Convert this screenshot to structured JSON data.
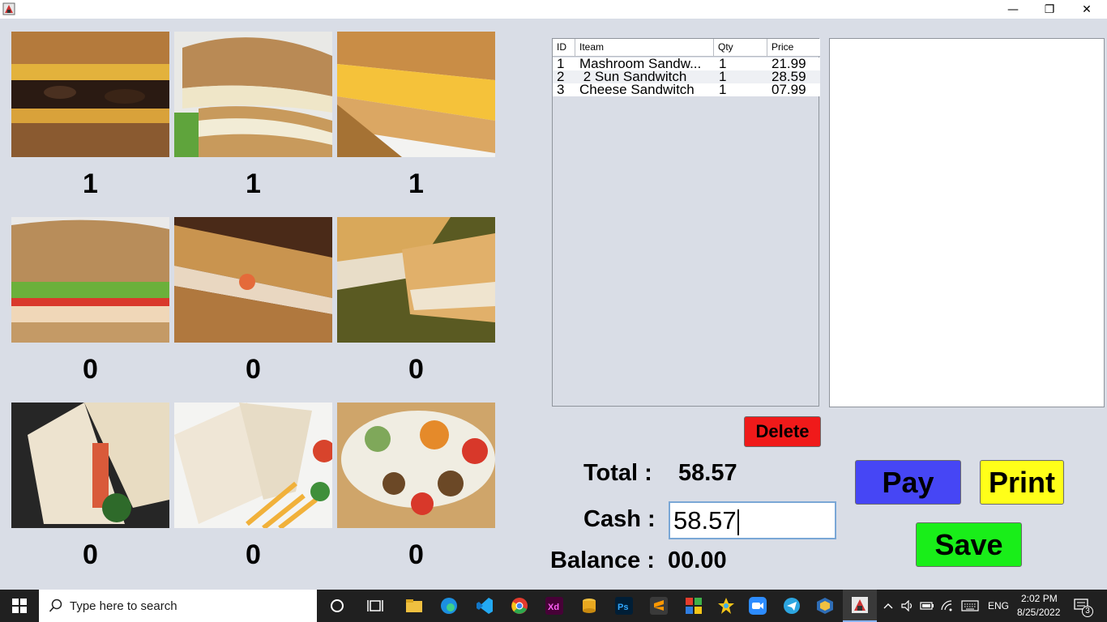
{
  "window": {
    "controls": {
      "minimize": "—",
      "restore": "❐",
      "close": "✕"
    }
  },
  "products": [
    {
      "name": "mashroom-sandwich",
      "qty": "1"
    },
    {
      "name": "sun-sandwich",
      "qty": "1"
    },
    {
      "name": "cheese-sandwich",
      "qty": "1"
    },
    {
      "name": "club-sandwich",
      "qty": "0"
    },
    {
      "name": "tuna-panini",
      "qty": "0"
    },
    {
      "name": "chicken-toast",
      "qty": "0"
    },
    {
      "name": "triangle-sandwich",
      "qty": "0"
    },
    {
      "name": "wrap",
      "qty": "0"
    },
    {
      "name": "falafel-pita",
      "qty": "0"
    }
  ],
  "table": {
    "headers": {
      "id": "ID",
      "item": "Iteam",
      "qty": "Qty",
      "price": "Price"
    },
    "rows": [
      {
        "id": "1",
        "item": "Mashroom Sandw...",
        "qty": "1",
        "price": "21.99"
      },
      {
        "id": "2",
        "item": " 2 Sun Sandwitch",
        "qty": "1",
        "price": "28.59"
      },
      {
        "id": "3",
        "item": "Cheese Sandwitch",
        "qty": "1",
        "price": "07.99"
      }
    ]
  },
  "actions": {
    "delete": "Delete",
    "pay": "Pay",
    "print": "Print",
    "save": "Save"
  },
  "summary": {
    "total_label": "Total :",
    "total_value": "58.57",
    "cash_label": "Cash :",
    "cash_value": "58.57",
    "balance_label": "Balance :",
    "balance_value": "00.00"
  },
  "colors": {
    "delete": "#f01a1a",
    "pay": "#4646f5",
    "print": "#ffff19",
    "save": "#19ee19"
  },
  "taskbar": {
    "search_placeholder": "Type here to search",
    "lang": "ENG",
    "time": "2:02 PM",
    "date": "8/25/2022",
    "notif_count": "3",
    "apps": [
      "task-view",
      "widgets",
      "file-explorer",
      "edge",
      "vscode",
      "chrome",
      "adobe-xd",
      "db-tool",
      "photoshop",
      "sublime",
      "office",
      "star-app",
      "zoom",
      "telegram",
      "virtualbox",
      "java-app"
    ]
  }
}
